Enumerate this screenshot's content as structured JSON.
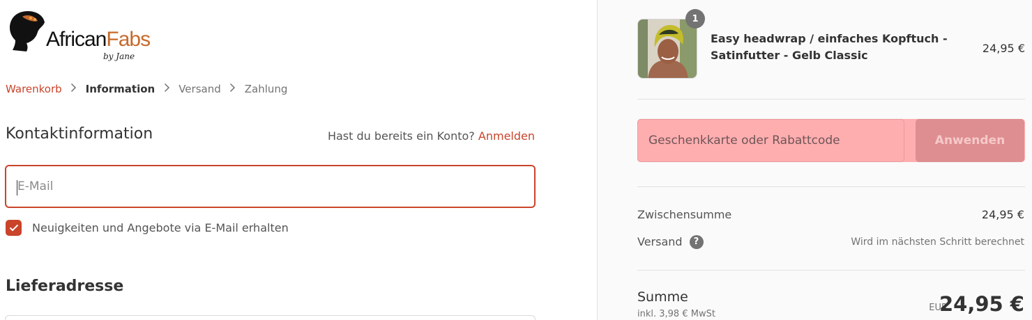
{
  "brand": {
    "name_part1": "African",
    "name_part2": "Fabs",
    "subline": "by Jane",
    "accent_color": "#c66a2b"
  },
  "breadcrumb": [
    {
      "label": "Warenkorb",
      "state": "link"
    },
    {
      "label": "Information",
      "state": "active"
    },
    {
      "label": "Versand",
      "state": "muted"
    },
    {
      "label": "Zahlung",
      "state": "muted"
    }
  ],
  "contact": {
    "title": "Kontaktinformation",
    "account_question": "Hast du bereits ein Konto?",
    "login_link": "Anmelden",
    "email_placeholder": "E-Mail",
    "email_value": "",
    "newsletter_label": "Neuigkeiten und Angebote via E-Mail erhalten",
    "newsletter_checked": true
  },
  "shipping": {
    "title": "Lieferadresse"
  },
  "order": {
    "product": {
      "name": "Easy headwrap / einfaches Kopftuch - Satinfutter - Gelb Classic",
      "quantity": "1",
      "price": "24,95 €"
    },
    "discount": {
      "placeholder": "Geschenkkarte oder Rabattcode",
      "apply_label": "Anwenden"
    },
    "subtotal_label": "Zwischensumme",
    "subtotal_value": "24,95 €",
    "shipping_label": "Versand",
    "shipping_help_icon": "question-icon",
    "shipping_value": "Wird im nächsten Schritt berechnet",
    "total_label": "Summe",
    "tax_note": "inkl. 3,98 € MwSt",
    "currency": "EUR",
    "total_value": "24,95 €"
  },
  "colors": {
    "accent": "#c9442a",
    "discount_bg": "#ffaeb0",
    "apply_btn": "#de8e90"
  }
}
